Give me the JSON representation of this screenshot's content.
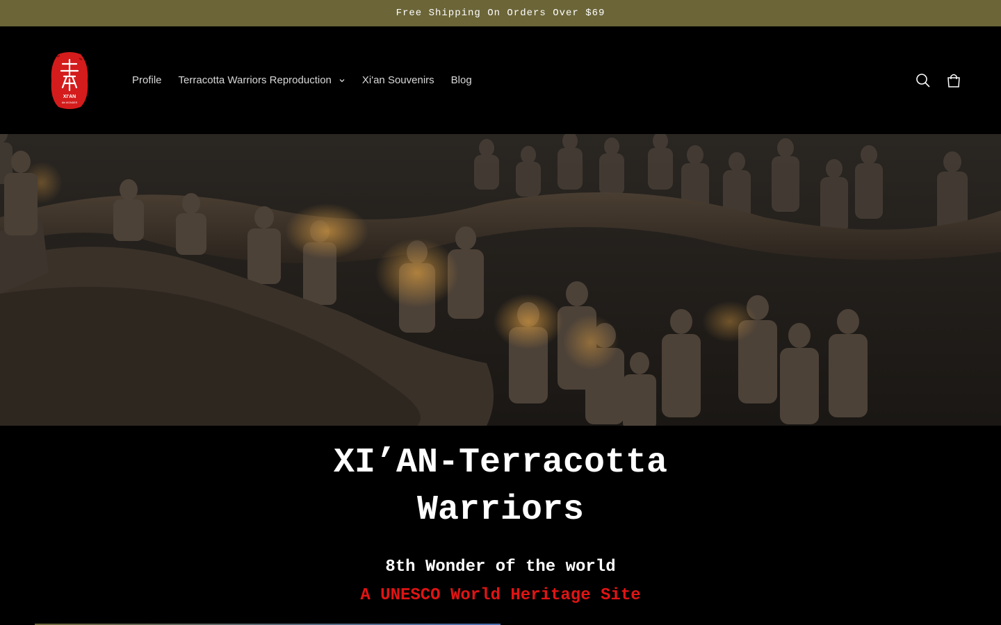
{
  "announcement": {
    "text": "Free Shipping On Orders Over $69"
  },
  "header": {
    "logo": {
      "text_top": "XI'AN",
      "text_bottom": "8th WONDER",
      "color": "#d41c1c"
    },
    "nav": [
      {
        "label": "Profile",
        "has_dropdown": false
      },
      {
        "label": "Terracotta Warriors Reproduction",
        "has_dropdown": true
      },
      {
        "label": "Xi'an Souvenirs",
        "has_dropdown": false
      },
      {
        "label": "Blog",
        "has_dropdown": false
      }
    ],
    "icons": [
      "search-icon",
      "cart-icon"
    ]
  },
  "hero": {
    "title": "XI’AN-Terracotta Warriors",
    "subtitle": "8th Wonder of the world",
    "tagline": "A UNESCO World Heritage Site",
    "tagline_color": "#e11414"
  },
  "colors": {
    "announcement_bg": "#6b6538",
    "page_bg": "#000000",
    "text": "#ffffff",
    "nav_text": "#d9d9d9"
  }
}
